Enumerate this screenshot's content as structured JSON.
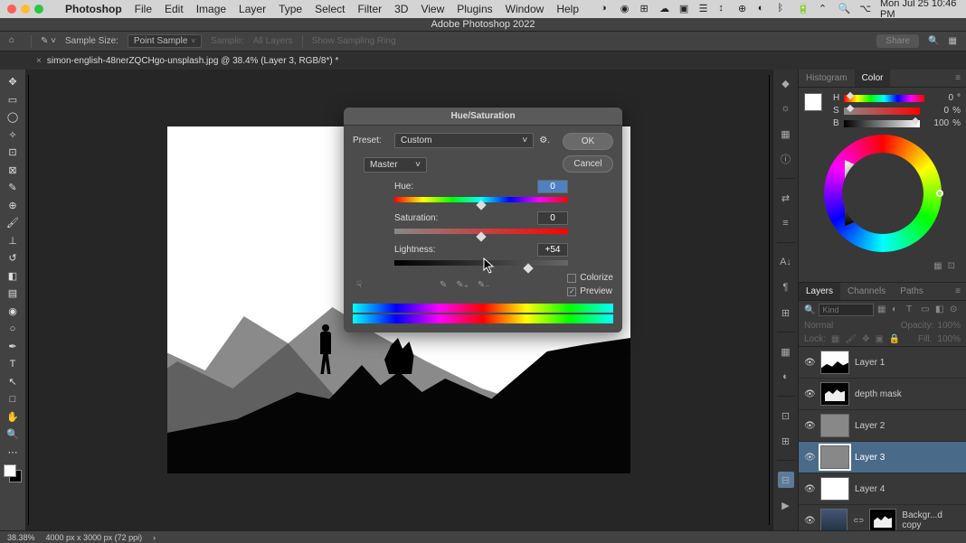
{
  "menubar": {
    "app": "Photoshop",
    "items": [
      "File",
      "Edit",
      "Image",
      "Layer",
      "Type",
      "Select",
      "Filter",
      "3D",
      "View",
      "Plugins",
      "Window",
      "Help"
    ],
    "datetime": "Mon Jul 25  10:46 PM"
  },
  "titlebar": {
    "title": "Adobe Photoshop 2022"
  },
  "optionsbar": {
    "sample_size_label": "Sample Size:",
    "sample_size_value": "Point Sample",
    "sample_label": "Sample:",
    "sample_value": "All Layers",
    "show_ring": "Show Sampling Ring",
    "share": "Share"
  },
  "tab": {
    "filename": "simon-english-48nerZQCHgo-unsplash.jpg @ 38.4% (Layer 3, RGB/8*) *"
  },
  "statusbar": {
    "zoom": "38.38%",
    "doc": "4000 px x 3000 px (72 ppi)"
  },
  "tools": [
    "move",
    "marquee",
    "lasso",
    "wand",
    "crop",
    "frame",
    "eyedropper",
    "heal",
    "brush",
    "stamp",
    "history",
    "eraser",
    "gradient",
    "blur",
    "dodge",
    "pen",
    "type",
    "path",
    "rect",
    "hand",
    "zoom"
  ],
  "color_panel": {
    "tabs": {
      "histogram": "Histogram",
      "color": "Color"
    },
    "h_label": "H",
    "h_value": "0",
    "h_unit": "°",
    "s_label": "S",
    "s_value": "0",
    "s_unit": "%",
    "b_label": "B",
    "b_value": "100",
    "b_unit": "%"
  },
  "layers_panel": {
    "tabs": {
      "layers": "Layers",
      "channels": "Channels",
      "paths": "Paths"
    },
    "filter_placeholder": "Kind",
    "blend": "Normal",
    "opacity_label": "Opacity:",
    "opacity_value": "100%",
    "lock_label": "Lock:",
    "fill_label": "Fill:",
    "fill_value": "100%",
    "layers": [
      {
        "name": "Layer 1",
        "thumb": "photo-sil"
      },
      {
        "name": "depth mask",
        "thumb": "mask"
      },
      {
        "name": "Layer 2",
        "thumb": "gray"
      },
      {
        "name": "Layer 3",
        "thumb": "gray",
        "selected": true
      },
      {
        "name": "Layer 4",
        "thumb": "white"
      },
      {
        "name": "Backgr...d copy",
        "thumb": "photo-pair"
      }
    ]
  },
  "dialog": {
    "title": "Hue/Saturation",
    "preset_label": "Preset:",
    "preset_value": "Custom",
    "ok": "OK",
    "cancel": "Cancel",
    "channel": "Master",
    "hue_label": "Hue:",
    "hue_value": "0",
    "sat_label": "Saturation:",
    "sat_value": "0",
    "light_label": "Lightness:",
    "light_value": "+54",
    "colorize": "Colorize",
    "preview": "Preview"
  },
  "chart_data": {
    "type": "table",
    "title": "Hue/Saturation adjustment values",
    "rows": [
      {
        "parameter": "Hue",
        "value": 0,
        "range": [
          -180,
          180
        ]
      },
      {
        "parameter": "Saturation",
        "value": 0,
        "range": [
          -100,
          100
        ]
      },
      {
        "parameter": "Lightness",
        "value": 54,
        "range": [
          -100,
          100
        ]
      }
    ]
  }
}
